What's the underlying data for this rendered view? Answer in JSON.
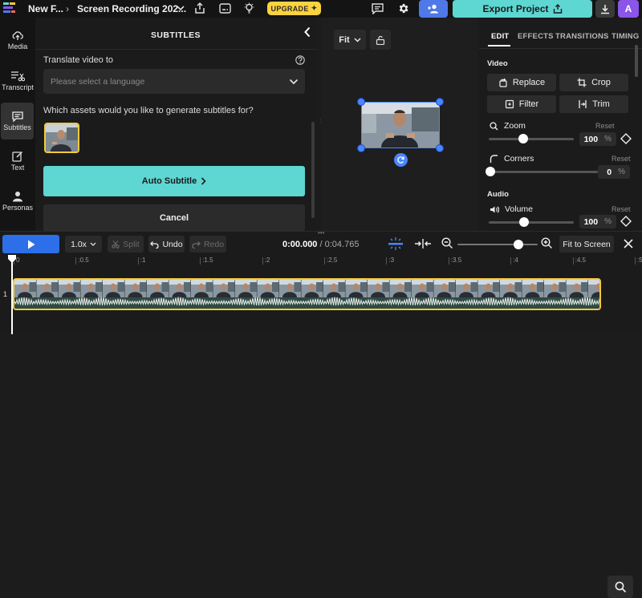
{
  "topbar": {
    "project_name": "New F...",
    "recording_name": "Screen Recording 202...",
    "upgrade_label": "UPGRADE",
    "export_label": "Export Project",
    "avatar_initial": "A"
  },
  "rail": {
    "items": [
      {
        "label": "Media",
        "icon": "cloud-upload-icon"
      },
      {
        "label": "Transcript",
        "icon": "transcript-icon"
      },
      {
        "label": "Subtitles",
        "icon": "subtitles-icon",
        "active": true
      },
      {
        "label": "Text",
        "icon": "text-icon"
      },
      {
        "label": "Personas",
        "icon": "persona-icon"
      }
    ]
  },
  "subtitles_panel": {
    "title": "SUBTITLES",
    "translate_label": "Translate video to",
    "language_placeholder": "Please select a language",
    "assets_question": "Which assets would you like to generate subtitles for?",
    "auto_subtitle_label": "Auto Subtitle",
    "cancel_label": "Cancel"
  },
  "preview": {
    "fit_label": "Fit"
  },
  "right_panel": {
    "tabs": [
      "EDIT",
      "EFFECTS",
      "TRANSITIONS",
      "TIMING"
    ],
    "active_tab": "EDIT",
    "video_section": "Video",
    "buttons": {
      "replace": "Replace",
      "crop": "Crop",
      "filter": "Filter",
      "trim": "Trim"
    },
    "zoom": {
      "label": "Zoom",
      "reset": "Reset",
      "value": "100",
      "unit": "%",
      "level": 0.37
    },
    "corners": {
      "label": "Corners",
      "reset": "Reset",
      "value": "0",
      "unit": "%",
      "level": 0.0
    },
    "audio_section": "Audio",
    "volume": {
      "label": "Volume",
      "reset": "Reset",
      "value": "100",
      "unit": "%",
      "level": 0.38
    }
  },
  "timeline": {
    "speed_label": "1.0x",
    "split_label": "Split",
    "undo_label": "Undo",
    "redo_label": "Redo",
    "current_time": "0:00.000",
    "separator": "/",
    "duration": "0:04.765",
    "zoom_level": 0.78,
    "fit_to_screen_label": "Fit to Screen",
    "ruler_labels": [
      "0",
      ":0.5",
      ":1",
      ":1.5",
      ":2",
      ":2.5",
      ":3",
      ":3.5",
      ":4",
      ":4.5",
      ":5"
    ],
    "track_number": "1"
  },
  "colors": {
    "accent_teal": "#5ed6d2",
    "accent_blue": "#2d6fe8",
    "upgrade_yellow": "#fbd33f",
    "avatar_purple": "#8a55e8",
    "clip_border": "#f4ca3a"
  }
}
